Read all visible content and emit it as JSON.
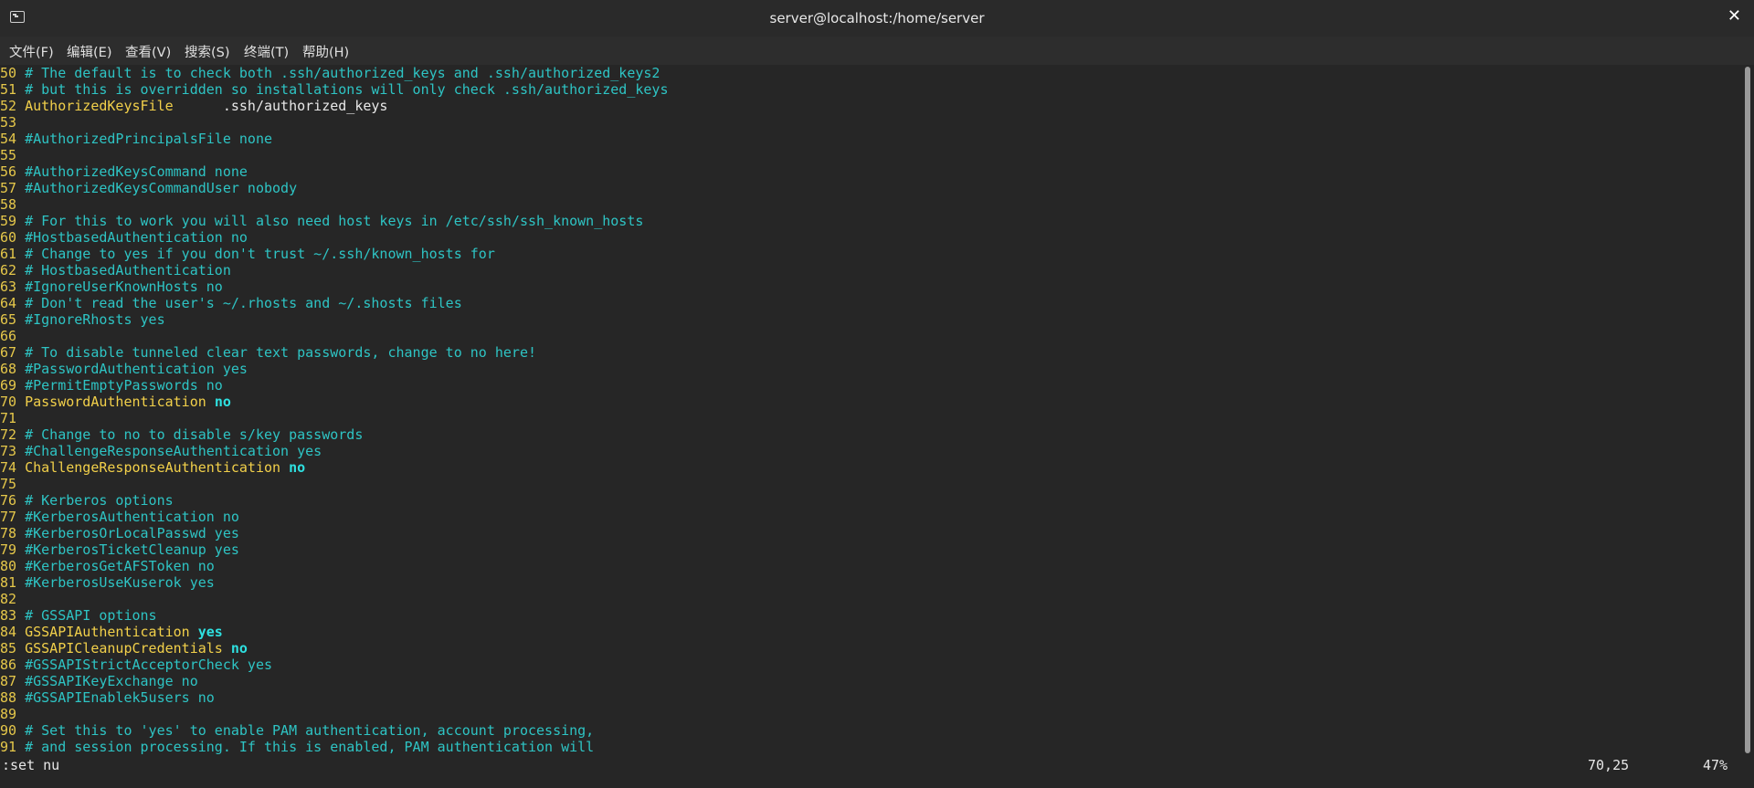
{
  "window": {
    "title": "server@localhost:/home/server",
    "icon": "terminal-icon",
    "close_label": "✕"
  },
  "menu": [
    {
      "label": "文件(F)"
    },
    {
      "label": "编辑(E)"
    },
    {
      "label": "查看(V)"
    },
    {
      "label": "搜索(S)"
    },
    {
      "label": "终端(T)"
    },
    {
      "label": "帮助(H)"
    }
  ],
  "editor": {
    "lines": [
      {
        "n": "50",
        "segs": [
          {
            "t": "# The default is to check both .ssh/authorized_keys and .ssh/authorized_keys2",
            "c": "cmt"
          }
        ]
      },
      {
        "n": "51",
        "segs": [
          {
            "t": "# but this is overridden so installations will only check .ssh/authorized_keys",
            "c": "cmt"
          }
        ]
      },
      {
        "n": "52",
        "segs": [
          {
            "t": "AuthorizedKeysFile",
            "c": "kw"
          },
          {
            "t": "      .ssh/authorized_keys",
            "c": "plain"
          }
        ]
      },
      {
        "n": "53",
        "segs": []
      },
      {
        "n": "54",
        "segs": [
          {
            "t": "#AuthorizedPrincipalsFile none",
            "c": "cmt"
          }
        ]
      },
      {
        "n": "55",
        "segs": []
      },
      {
        "n": "56",
        "segs": [
          {
            "t": "#AuthorizedKeysCommand none",
            "c": "cmt"
          }
        ]
      },
      {
        "n": "57",
        "segs": [
          {
            "t": "#AuthorizedKeysCommandUser nobody",
            "c": "cmt"
          }
        ]
      },
      {
        "n": "58",
        "segs": []
      },
      {
        "n": "59",
        "segs": [
          {
            "t": "# For this to work you will also need host keys in /etc/ssh/ssh_known_hosts",
            "c": "cmt"
          }
        ]
      },
      {
        "n": "60",
        "segs": [
          {
            "t": "#HostbasedAuthentication no",
            "c": "cmt"
          }
        ]
      },
      {
        "n": "61",
        "segs": [
          {
            "t": "# Change to yes if you don't trust ~/.ssh/known_hosts for",
            "c": "cmt"
          }
        ]
      },
      {
        "n": "62",
        "segs": [
          {
            "t": "# HostbasedAuthentication",
            "c": "cmt"
          }
        ]
      },
      {
        "n": "63",
        "segs": [
          {
            "t": "#IgnoreUserKnownHosts no",
            "c": "cmt"
          }
        ]
      },
      {
        "n": "64",
        "segs": [
          {
            "t": "# Don't read the user's ~/.rhosts and ~/.shosts files",
            "c": "cmt"
          }
        ]
      },
      {
        "n": "65",
        "segs": [
          {
            "t": "#IgnoreRhosts yes",
            "c": "cmt"
          }
        ]
      },
      {
        "n": "66",
        "segs": []
      },
      {
        "n": "67",
        "segs": [
          {
            "t": "# To disable tunneled clear text passwords, change to no here!",
            "c": "cmt"
          }
        ]
      },
      {
        "n": "68",
        "segs": [
          {
            "t": "#PasswordAuthentication yes",
            "c": "cmt"
          }
        ]
      },
      {
        "n": "69",
        "segs": [
          {
            "t": "#PermitEmptyPasswords no",
            "c": "cmt"
          }
        ]
      },
      {
        "n": "70",
        "segs": [
          {
            "t": "PasswordAuthentication",
            "c": "kw"
          },
          {
            "t": " ",
            "c": "plain"
          },
          {
            "t": "no",
            "c": "val"
          }
        ]
      },
      {
        "n": "71",
        "segs": []
      },
      {
        "n": "72",
        "segs": [
          {
            "t": "# Change to no to disable s/key passwords",
            "c": "cmt"
          }
        ]
      },
      {
        "n": "73",
        "segs": [
          {
            "t": "#ChallengeResponseAuthentication yes",
            "c": "cmt"
          }
        ]
      },
      {
        "n": "74",
        "segs": [
          {
            "t": "ChallengeResponseAuthentication",
            "c": "kw"
          },
          {
            "t": " ",
            "c": "plain"
          },
          {
            "t": "no",
            "c": "val"
          }
        ]
      },
      {
        "n": "75",
        "segs": []
      },
      {
        "n": "76",
        "segs": [
          {
            "t": "# Kerberos options",
            "c": "cmt"
          }
        ]
      },
      {
        "n": "77",
        "segs": [
          {
            "t": "#KerberosAuthentication no",
            "c": "cmt"
          }
        ]
      },
      {
        "n": "78",
        "segs": [
          {
            "t": "#KerberosOrLocalPasswd yes",
            "c": "cmt"
          }
        ]
      },
      {
        "n": "79",
        "segs": [
          {
            "t": "#KerberosTicketCleanup yes",
            "c": "cmt"
          }
        ]
      },
      {
        "n": "80",
        "segs": [
          {
            "t": "#KerberosGetAFSToken no",
            "c": "cmt"
          }
        ]
      },
      {
        "n": "81",
        "segs": [
          {
            "t": "#KerberosUseKuserok yes",
            "c": "cmt"
          }
        ]
      },
      {
        "n": "82",
        "segs": []
      },
      {
        "n": "83",
        "segs": [
          {
            "t": "# GSSAPI options",
            "c": "cmt"
          }
        ]
      },
      {
        "n": "84",
        "segs": [
          {
            "t": "GSSAPIAuthentication",
            "c": "kw"
          },
          {
            "t": " ",
            "c": "plain"
          },
          {
            "t": "yes",
            "c": "val"
          }
        ]
      },
      {
        "n": "85",
        "segs": [
          {
            "t": "GSSAPICleanupCredentials",
            "c": "kw"
          },
          {
            "t": " ",
            "c": "plain"
          },
          {
            "t": "no",
            "c": "val"
          }
        ]
      },
      {
        "n": "86",
        "segs": [
          {
            "t": "#GSSAPIStrictAcceptorCheck yes",
            "c": "cmt"
          }
        ]
      },
      {
        "n": "87",
        "segs": [
          {
            "t": "#GSSAPIKeyExchange no",
            "c": "cmt"
          }
        ]
      },
      {
        "n": "88",
        "segs": [
          {
            "t": "#GSSAPIEnablek5users no",
            "c": "cmt"
          }
        ]
      },
      {
        "n": "89",
        "segs": []
      },
      {
        "n": "90",
        "segs": [
          {
            "t": "# Set this to 'yes' to enable PAM authentication, account processing,",
            "c": "cmt"
          }
        ]
      },
      {
        "n": "91",
        "segs": [
          {
            "t": "# and session processing. If this is enabled, PAM authentication will",
            "c": "cmt"
          }
        ]
      }
    ]
  },
  "status": {
    "command": ":set nu",
    "position": "70,25",
    "percent": "47%"
  },
  "colors": {
    "line_number": "#e6c84a",
    "comment": "#2ec4c4",
    "keyword": "#f2d04a",
    "value": "#2ee0e0",
    "background": "#262626"
  }
}
